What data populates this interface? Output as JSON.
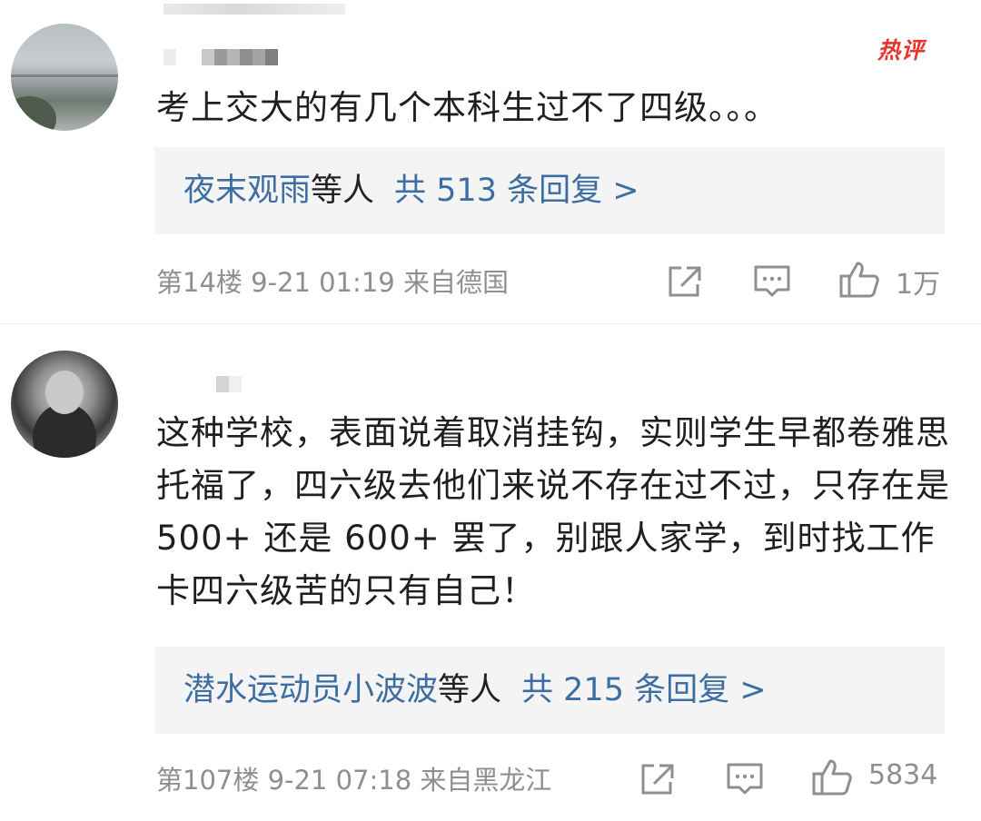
{
  "hot_badge": "热评",
  "comments": [
    {
      "text": "考上交大的有几个本科生过不了四级。。。",
      "reply_names": "夜末观雨",
      "reply_etc": "等人",
      "reply_count": "共 513 条回复 >",
      "meta": "第14楼  9-21 01:19  来自德国",
      "likes": "1万",
      "avatar_icon": "lake-landscape-avatar"
    },
    {
      "text": "这种学校，表面说着取消挂钩，实则学生早都卷雅思托福了，四六级去他们来说不存在过不过，只存在是 500+ 还是 600+ 罢了，别跟人家学，到时找工作卡四六级苦的只有自己！",
      "reply_names": "潜水运动员小波波",
      "reply_etc": "等人",
      "reply_count": "共 215 条回复 >",
      "meta": "第107楼  9-21 07:18  来自黑龙江",
      "likes": "5834",
      "avatar_icon": "portrait-sketch-avatar"
    }
  ],
  "icons": {
    "share": "share-icon",
    "comment": "comment-icon",
    "like": "thumbs-up-icon"
  },
  "colors": {
    "link": "#3d6ea3",
    "hot": "#e8322c",
    "meta": "#8f8f8f",
    "reply_bg": "#f4f4f4"
  }
}
